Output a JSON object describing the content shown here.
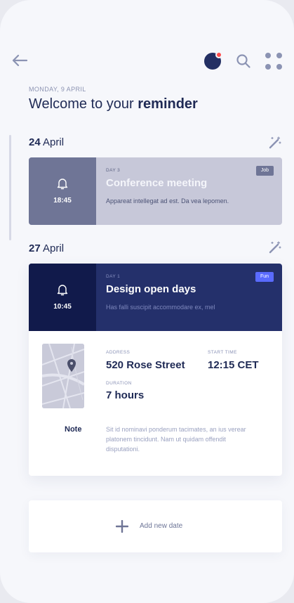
{
  "header": {
    "icons": [
      "back-arrow-icon",
      "avatar",
      "search-icon",
      "menu-grid-icon"
    ],
    "notification_color": "#ff4d4d"
  },
  "greeting": {
    "date": "MONDAY, 9 APRIL",
    "title_prefix": "Welcome to your ",
    "title_bold": "reminder"
  },
  "groups": [
    {
      "day": "24",
      "month": "April",
      "event": {
        "time": "18:45",
        "day_tag": "DAY 3",
        "title": "Conference meeting",
        "description": "Appareat intellegat ad est. Da vea lepomen.",
        "badge": "Job"
      }
    },
    {
      "day": "27",
      "month": "April",
      "event": {
        "time": "10:45",
        "day_tag": "DAY 1",
        "title": "Design open days",
        "description": "Has falli suscipit accommodare ex, mel",
        "badge": "Fun",
        "details": {
          "address_label": "ADDRESS",
          "address": "520 Rose Street",
          "start_label": "START TIME",
          "start": "12:15 CET",
          "duration_label": "DURATION",
          "duration": "7 hours",
          "note_label": "Note",
          "note": "Sit id nominavi ponderum tacimates, an ius verear platonem tincidunt. Nam ut quidam offendit disputationi."
        }
      }
    }
  ],
  "add": {
    "label": "Add new date"
  },
  "colors": {
    "navy": "#24306b",
    "navy_dark": "#111a4b",
    "grey_card": "#c7c8d9",
    "fun_badge": "#5a6bff"
  }
}
